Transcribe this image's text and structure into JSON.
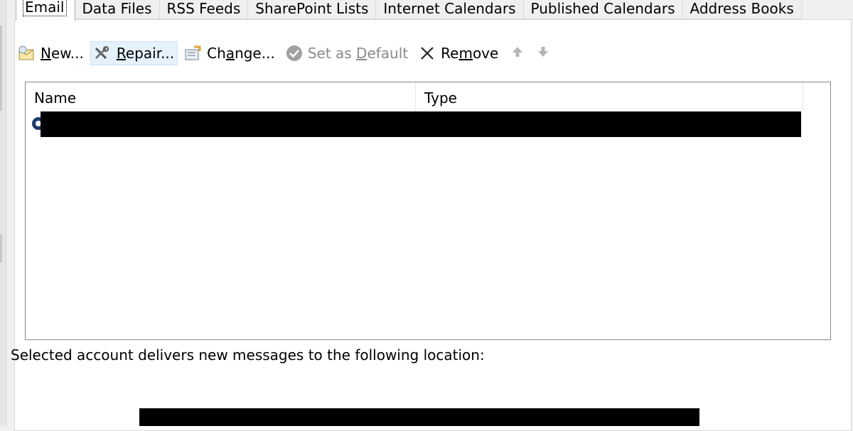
{
  "tabs": [
    {
      "label": "Email",
      "active": true
    },
    {
      "label": "Data Files"
    },
    {
      "label": "RSS Feeds"
    },
    {
      "label": "SharePoint Lists"
    },
    {
      "label": "Internet Calendars"
    },
    {
      "label": "Published Calendars"
    },
    {
      "label": "Address Books"
    }
  ],
  "toolbar": {
    "new": {
      "pre": "",
      "u": "N",
      "post": "ew...",
      "icon": "new-mail-icon"
    },
    "repair": {
      "pre": "",
      "u": "R",
      "post": "epair...",
      "icon": "repair-tools-icon"
    },
    "change": {
      "pre": "Ch",
      "u": "a",
      "post": "nge...",
      "icon": "change-account-icon"
    },
    "set_default": {
      "pre": "Set as ",
      "u": "D",
      "post": "efault",
      "icon": "checkmark-icon",
      "disabled": true
    },
    "remove": {
      "pre": "Re",
      "u": "m",
      "post": "ove",
      "icon": "close-x-icon"
    },
    "move_up": {
      "icon": "arrow-up-icon"
    },
    "move_down": {
      "icon": "arrow-down-icon"
    }
  },
  "list": {
    "columns": [
      "Name",
      "Type"
    ],
    "rows": [
      {
        "name": "",
        "type": "",
        "redacted": true
      }
    ]
  },
  "delivers_text": "Selected account delivers new messages to the following location:",
  "colors": {
    "redaction": "#000000",
    "selection_hover": "#e5f1fb",
    "window_bg": "#f0f0f0"
  }
}
